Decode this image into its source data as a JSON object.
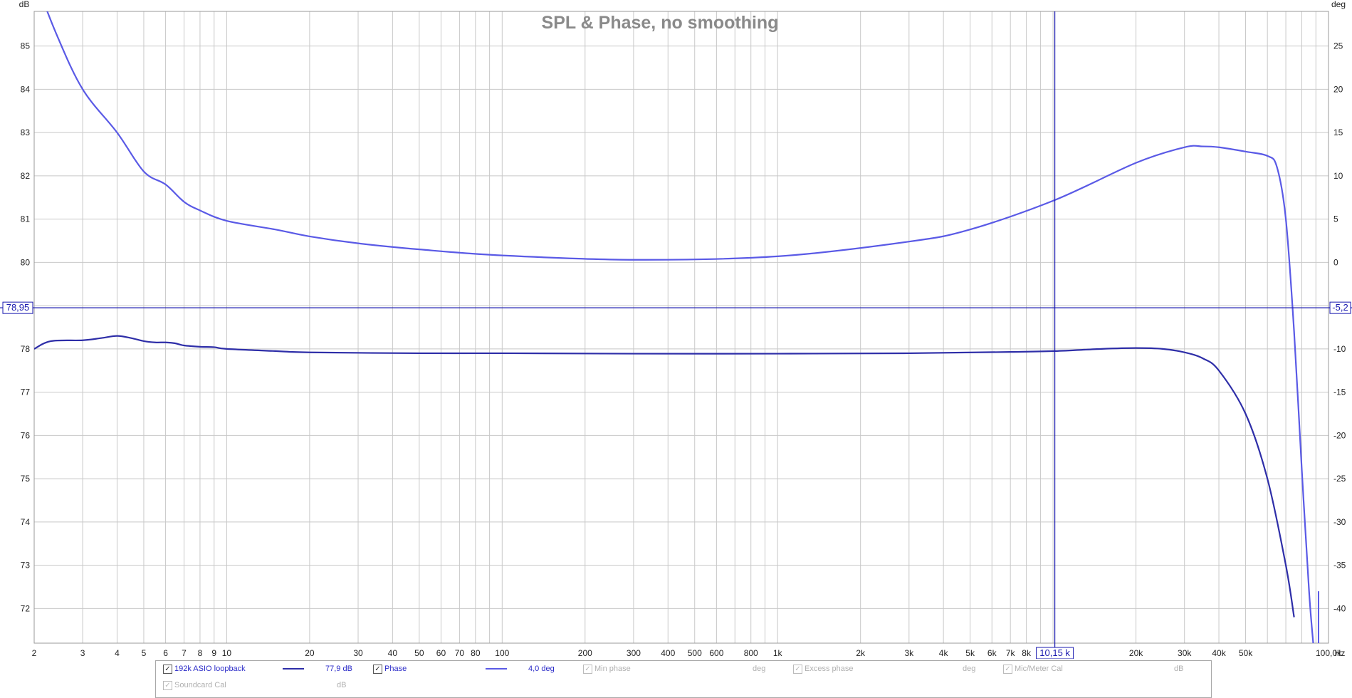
{
  "chart_data": {
    "type": "line",
    "title": "SPL & Phase, no smoothing",
    "xlabel": "Hz",
    "ylabel": "dB",
    "y2label": "deg",
    "x_scale": "log",
    "xlim": [
      2,
      100000
    ],
    "ylim": [
      71.2,
      85.8
    ],
    "y2lim": [
      -44,
      29
    ],
    "x_ticks": [
      2,
      3,
      4,
      5,
      6,
      7,
      8,
      9,
      10,
      20,
      30,
      40,
      50,
      60,
      70,
      80,
      100,
      200,
      300,
      400,
      500,
      600,
      800,
      1000,
      2000,
      3000,
      4000,
      5000,
      6000,
      7000,
      8000,
      20000,
      30000,
      40000,
      50000,
      100000
    ],
    "x_tick_labels": [
      "2",
      "3",
      "4",
      "5",
      "6",
      "7",
      "8",
      "9",
      "10",
      "20",
      "30",
      "40",
      "50",
      "60",
      "70",
      "80",
      "100",
      "200",
      "300",
      "400",
      "500",
      "600",
      "800",
      "1k",
      "2k",
      "3k",
      "4k",
      "5k",
      "6k",
      "7k",
      "8k",
      "20k",
      "30k",
      "40k",
      "50k",
      "100,0k"
    ],
    "y_ticks": [
      72,
      73,
      74,
      75,
      76,
      77,
      78,
      80,
      81,
      82,
      83,
      84,
      85
    ],
    "y2_ticks": [
      -40,
      -35,
      -30,
      -25,
      -20,
      -15,
      -10,
      0,
      5,
      10,
      15,
      20,
      25
    ],
    "cursor": {
      "x": 10150,
      "x_label": "10,15 k",
      "y_label": "78,95",
      "y2_label": "-5,2",
      "y": 78.95
    },
    "grid": true,
    "series": [
      {
        "name": "192k ASIO loopback",
        "axis": "left",
        "color": "#2e2ea8",
        "x": [
          2,
          2.3,
          3,
          3.5,
          4,
          4.5,
          5,
          5.5,
          6,
          6.5,
          7,
          8,
          9,
          10,
          15,
          20,
          50,
          100,
          300,
          1000,
          3000,
          7000,
          10150,
          15000,
          20000,
          25000,
          30000,
          35000,
          40000,
          50000,
          60000,
          70000,
          75000
        ],
        "y": [
          78.0,
          78.18,
          78.2,
          78.25,
          78.3,
          78.25,
          78.18,
          78.15,
          78.15,
          78.13,
          78.08,
          78.05,
          78.04,
          78.0,
          77.95,
          77.92,
          77.9,
          77.9,
          77.89,
          77.89,
          77.9,
          77.93,
          77.95,
          78.0,
          78.02,
          78.0,
          77.92,
          77.78,
          77.5,
          76.5,
          75.0,
          73.0,
          71.8
        ]
      },
      {
        "name": "Phase",
        "axis": "right",
        "color": "#5a5ae6",
        "x": [
          2,
          2.4,
          3,
          4,
          5,
          6,
          7,
          8,
          10,
          15,
          20,
          30,
          50,
          100,
          300,
          1000,
          3000,
          5000,
          10150,
          20000,
          30000,
          35000,
          40000,
          50000,
          60000,
          65000,
          70000,
          75000,
          80000,
          85000,
          88000
        ],
        "y": [
          33,
          26.5,
          20.0,
          15.0,
          10.5,
          9.0,
          7.0,
          6.0,
          4.8,
          3.8,
          3.0,
          2.2,
          1.5,
          0.8,
          0.3,
          0.7,
          2.4,
          3.8,
          7.2,
          11.5,
          13.3,
          13.4,
          13.3,
          12.8,
          12.3,
          11.0,
          5.0,
          -8.0,
          -24.0,
          -38.0,
          -44.0
        ]
      }
    ],
    "legend": [
      {
        "label": "192k ASIO loopback",
        "value": "77,9 dB",
        "checked": true,
        "enabled": true,
        "color": "#2e2ea8"
      },
      {
        "label": "Phase",
        "value": "4,0 deg",
        "checked": true,
        "enabled": true,
        "color": "#5a5ae6"
      },
      {
        "label": "Min phase",
        "value": "deg",
        "checked": true,
        "enabled": false
      },
      {
        "label": "Excess phase",
        "value": "deg",
        "checked": true,
        "enabled": false
      },
      {
        "label": "Mic/Meter Cal",
        "value": "dB",
        "checked": true,
        "enabled": false
      },
      {
        "label": "Soundcard Cal",
        "value": "dB",
        "checked": true,
        "enabled": false
      }
    ]
  }
}
